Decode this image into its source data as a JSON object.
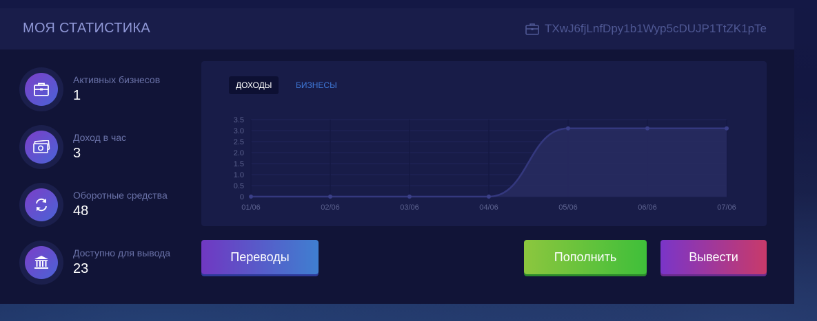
{
  "header": {
    "title": "МОЯ СТАТИСТИКА",
    "wallet_address": "TXwJ6fjLnfDpy1b1Wyp5cDUJP1TtZK1pTe"
  },
  "stats": [
    {
      "label": "Активных бизнесов",
      "value": "1",
      "icon": "briefcase-icon"
    },
    {
      "label": "Доход в час",
      "value": "3",
      "icon": "money-icon"
    },
    {
      "label": "Оборотные средства",
      "value": "48",
      "icon": "refresh-icon"
    },
    {
      "label": "Доступно для вывода",
      "value": "23",
      "icon": "bank-icon"
    }
  ],
  "chart_tabs": {
    "income": "ДОХОДЫ",
    "businesses": "БИЗНЕСЫ"
  },
  "chart_data": {
    "type": "area",
    "categories": [
      "01/06",
      "02/06",
      "03/06",
      "04/06",
      "05/06",
      "06/06",
      "07/06"
    ],
    "values": [
      0,
      0,
      0,
      0,
      3.1,
      3.1,
      3.1
    ],
    "ylim": [
      0,
      3.5
    ],
    "yticks": [
      "0",
      "0.5",
      "1.0",
      "1.5",
      "2.0",
      "2.5",
      "3.0",
      "3.5"
    ],
    "grid": true,
    "colors": {
      "line": "#34387e",
      "fill": "#282b62",
      "tick": "#5c628f"
    }
  },
  "buttons": {
    "transfers": "Переводы",
    "deposit": "Пополнить",
    "withdraw": "Вывести"
  }
}
